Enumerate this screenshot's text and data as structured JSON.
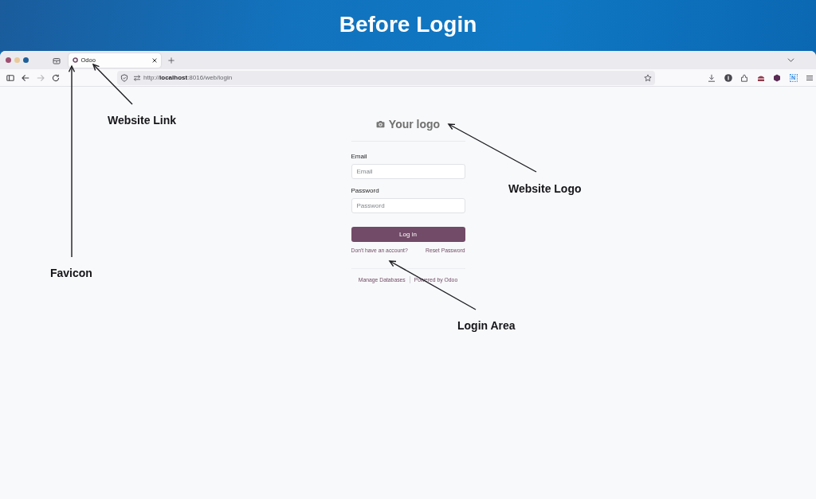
{
  "banner": {
    "title": "Before Login"
  },
  "browser": {
    "tabs": [
      {
        "title": "Odoo",
        "selected": true
      }
    ],
    "nav_buttons": [
      {
        "kind": "sidebar",
        "disabled": false
      },
      {
        "kind": "back",
        "disabled": false
      },
      {
        "kind": "forward",
        "disabled": true
      },
      {
        "kind": "reload",
        "disabled": false
      }
    ],
    "address": "http://**localhost**:8016/web/login",
    "extension_label": "N"
  },
  "login": {
    "logo_text": "Your logo",
    "fields": [
      {
        "label": "Email",
        "placeholder": "Email"
      },
      {
        "label": "Password",
        "placeholder": "Password"
      }
    ],
    "submit": "Log in",
    "links": [
      "Don't have an account?",
      "Reset Password"
    ],
    "footer_links": [
      "Manage Databases",
      "Powered by Odoo"
    ]
  },
  "annotations": [
    {
      "label": "Website Link"
    },
    {
      "label": "Website Logo"
    },
    {
      "label": "Favicon"
    },
    {
      "label": "Login Area"
    }
  ]
}
